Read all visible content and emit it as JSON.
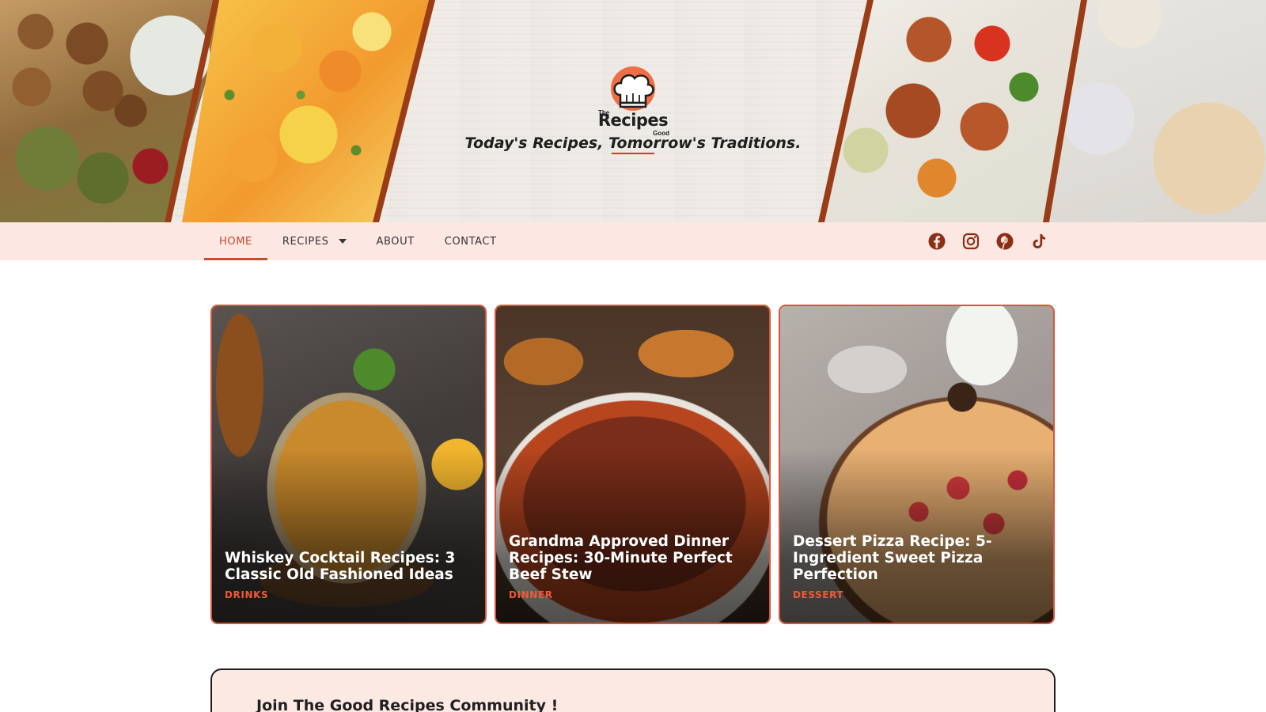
{
  "header": {
    "logo": {
      "small_top": "The",
      "word": "Recipes",
      "small_bottom": "Good"
    },
    "tagline": "Today's Recipes, Tomorrow's Traditions."
  },
  "nav": {
    "items": [
      {
        "label": "HOME",
        "active": true
      },
      {
        "label": "RECIPES",
        "active": false,
        "has_dropdown": true
      },
      {
        "label": "ABOUT",
        "active": false
      },
      {
        "label": "CONTACT",
        "active": false
      }
    ],
    "socials": [
      "facebook-icon",
      "instagram-icon",
      "pinterest-icon",
      "tiktok-icon"
    ]
  },
  "cards": [
    {
      "title": "Whiskey Cocktail Recipes: 3 Classic Old Fashioned Ideas",
      "category": "DRINKS"
    },
    {
      "title": "Grandma Approved Dinner Recipes: 30-Minute Perfect Beef Stew",
      "category": "DINNER"
    },
    {
      "title": "Dessert Pizza Recipe: 5-Ingredient Sweet Pizza Perfection",
      "category": "DESSERT"
    }
  ],
  "community": {
    "title": "Join The Good Recipes Community !"
  },
  "colors": {
    "accent": "#c94b28",
    "nav_bg": "#fde7e2",
    "category": "#f05a34",
    "logo_circle": "#f06e45"
  }
}
